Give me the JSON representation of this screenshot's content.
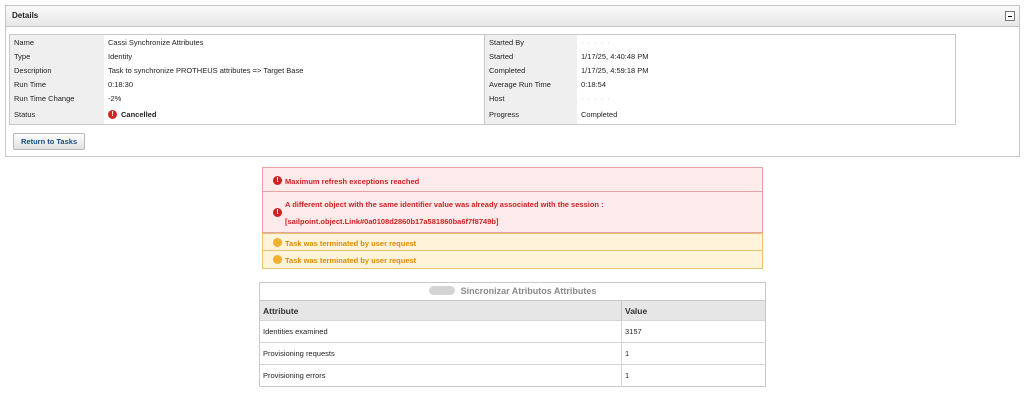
{
  "panel": {
    "title": "Details",
    "collapse_icon": "minus-icon"
  },
  "details": {
    "left": [
      {
        "label": "Name",
        "value": "Cassi Synchronize Attributes"
      },
      {
        "label": "Type",
        "value": "Identity"
      },
      {
        "label": "Description",
        "value": "Task to synchronize PROTHEUS attributes => Target Base"
      },
      {
        "label": "Run Time",
        "value": "0:18:30"
      },
      {
        "label": "Run Time Change",
        "value": "-2%"
      },
      {
        "label": "Status",
        "value": "Cancelled",
        "icon": "error-icon"
      }
    ],
    "right": [
      {
        "label": "Started By",
        "value": "· · · · ·"
      },
      {
        "label": "Started",
        "value": "1/17/25, 4:40:48 PM"
      },
      {
        "label": "Completed",
        "value": "1/17/25, 4:59:18 PM"
      },
      {
        "label": "Average Run Time",
        "value": "0:18:54"
      },
      {
        "label": "Host",
        "value": "· · · · ·"
      },
      {
        "label": "Progress",
        "value": "Completed"
      }
    ]
  },
  "return_button": "Return to Tasks",
  "messages": [
    {
      "type": "error",
      "text": "Maximum refresh exceptions reached"
    },
    {
      "type": "error",
      "text": "A different object with the same identifier value was already associated with the session :",
      "text2": "[sailpoint.object.Link#0a0108d2860b17a581860ba6f7f8749b]"
    },
    {
      "type": "warn",
      "text": "Task was terminated by user request"
    },
    {
      "type": "warn",
      "text": "Task was terminated by user request"
    }
  ],
  "attributes": {
    "title": "Sincronizar Atributos Attributes",
    "columns": [
      "Attribute",
      "Value"
    ],
    "rows": [
      {
        "attribute": "Identities examined",
        "value": "3157"
      },
      {
        "attribute": "Provisioning requests",
        "value": "1"
      },
      {
        "attribute": "Provisioning errors",
        "value": "1"
      }
    ]
  },
  "colors": {
    "error": "#cc2222",
    "warning": "#e08a00",
    "link": "#1a4a88"
  }
}
